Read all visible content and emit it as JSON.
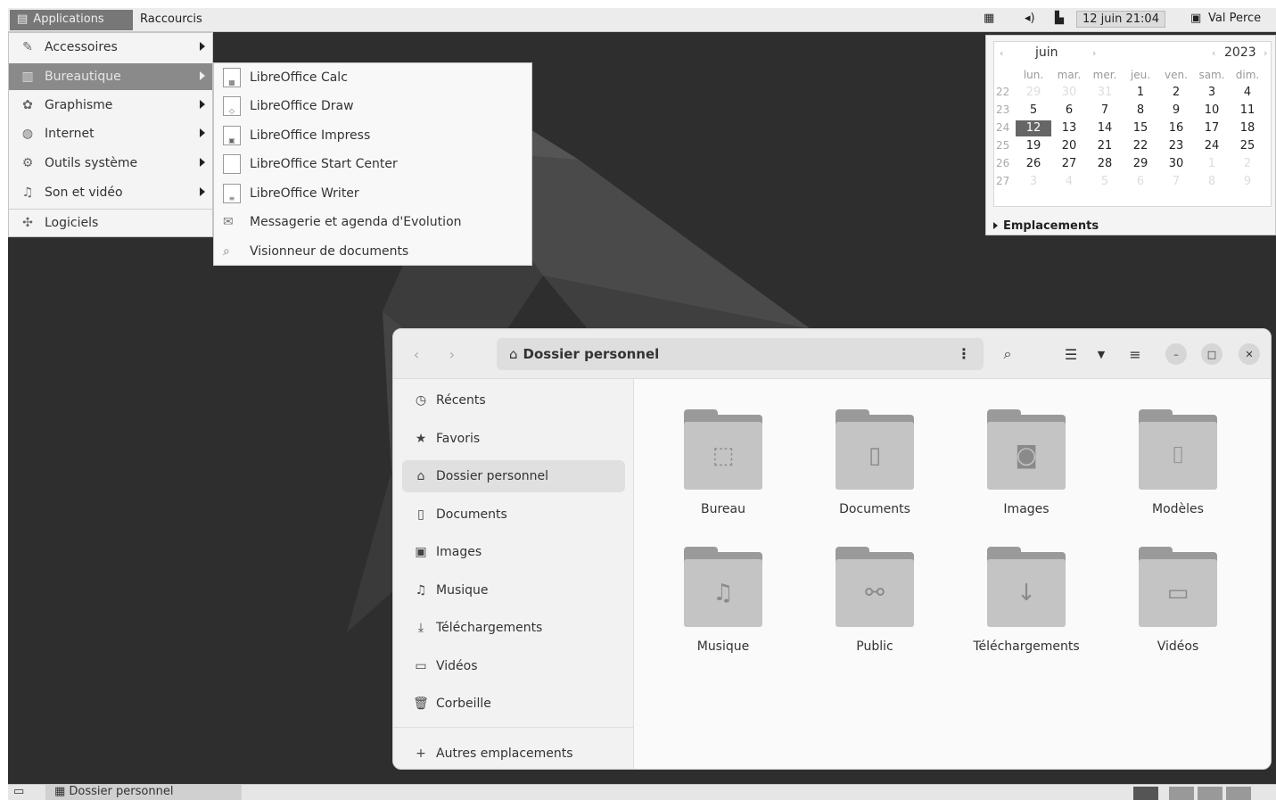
{
  "top_panel": {
    "applications_label": "Applications",
    "shortcuts_label": "Raccourcis",
    "clock": "12 juin 21:04",
    "user": "Val Perce"
  },
  "app_menu": {
    "items": [
      {
        "label": "Accessoires",
        "icon": "accessories-icon"
      },
      {
        "label": "Bureautique",
        "icon": "office-icon"
      },
      {
        "label": "Graphisme",
        "icon": "graphics-icon"
      },
      {
        "label": "Internet",
        "icon": "internet-icon"
      },
      {
        "label": "Outils système",
        "icon": "system-tools-icon"
      },
      {
        "label": "Son et vidéo",
        "icon": "sound-video-icon"
      },
      {
        "label": "Logiciels",
        "icon": "software-icon"
      }
    ]
  },
  "submenu": {
    "items": [
      {
        "label": "LibreOffice Calc"
      },
      {
        "label": "LibreOffice Draw"
      },
      {
        "label": "LibreOffice Impress"
      },
      {
        "label": "LibreOffice Start Center"
      },
      {
        "label": "LibreOffice Writer"
      },
      {
        "label": "Messagerie et agenda d'Evolution"
      },
      {
        "label": "Visionneur de documents"
      }
    ]
  },
  "calendar": {
    "month": "juin",
    "year": "2023",
    "day_headers": [
      "lun.",
      "mar.",
      "mer.",
      "jeu.",
      "ven.",
      "sam.",
      "dim."
    ],
    "weeks": [
      {
        "num": "22",
        "days": [
          "29",
          "30",
          "31",
          "1",
          "2",
          "3",
          "4"
        ]
      },
      {
        "num": "23",
        "days": [
          "5",
          "6",
          "7",
          "8",
          "9",
          "10",
          "11"
        ]
      },
      {
        "num": "24",
        "days": [
          "12",
          "13",
          "14",
          "15",
          "16",
          "17",
          "18"
        ]
      },
      {
        "num": "25",
        "days": [
          "19",
          "20",
          "21",
          "22",
          "23",
          "24",
          "25"
        ]
      },
      {
        "num": "26",
        "days": [
          "26",
          "27",
          "28",
          "29",
          "30",
          "1",
          "2"
        ]
      },
      {
        "num": "27",
        "days": [
          "3",
          "4",
          "5",
          "6",
          "7",
          "8",
          "9"
        ]
      }
    ],
    "selected_day": "12",
    "locations_label": "Emplacements"
  },
  "file_manager": {
    "path": "Dossier personnel",
    "sidebar": [
      {
        "label": "Récents",
        "icon": "clock-icon"
      },
      {
        "label": "Favoris",
        "icon": "star-icon"
      },
      {
        "label": "Dossier personnel",
        "icon": "home-icon"
      },
      {
        "label": "Documents",
        "icon": "document-icon"
      },
      {
        "label": "Images",
        "icon": "image-icon"
      },
      {
        "label": "Musique",
        "icon": "music-icon"
      },
      {
        "label": "Téléchargements",
        "icon": "download-icon"
      },
      {
        "label": "Vidéos",
        "icon": "video-icon"
      },
      {
        "label": "Corbeille",
        "icon": "trash-icon"
      }
    ],
    "other_locations": "Autres emplacements",
    "folders": [
      {
        "label": "Bureau",
        "icon": "desktop-folder-icon"
      },
      {
        "label": "Documents",
        "icon": "documents-folder-icon"
      },
      {
        "label": "Images",
        "icon": "pictures-folder-icon"
      },
      {
        "label": "Modèles",
        "icon": "templates-folder-icon"
      },
      {
        "label": "Musique",
        "icon": "music-folder-icon"
      },
      {
        "label": "Public",
        "icon": "public-folder-icon"
      },
      {
        "label": "Téléchargements",
        "icon": "downloads-folder-icon"
      },
      {
        "label": "Vidéos",
        "icon": "videos-folder-icon"
      }
    ]
  },
  "taskbar": {
    "task_label": "Dossier personnel"
  }
}
